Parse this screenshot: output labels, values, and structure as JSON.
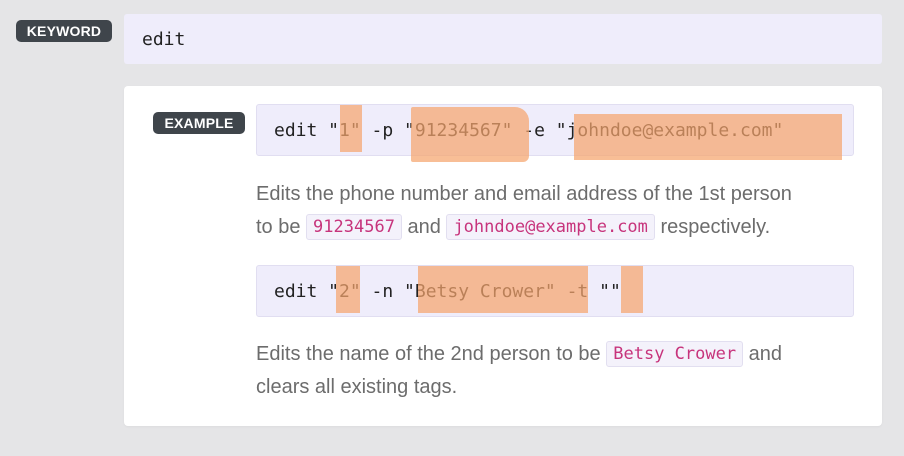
{
  "keyword": {
    "badge": "KEYWORD",
    "value": "edit"
  },
  "example": {
    "badge": "EXAMPLE",
    "code1": "edit \"1\" -p \"91234567\" -e \"johndoe@example.com\"",
    "desc1": {
      "line1": "Edits the phone number and email address of the 1st person",
      "line2_prefix": "to be",
      "code_a": "91234567",
      "mid": "and",
      "code_b": "johndoe@example.com",
      "suffix": "respectively."
    },
    "code2": "edit \"2\" -n \"Betsy Crower\" -t \"\"",
    "desc2": {
      "prefix": "Edits the name of the 2nd person to be",
      "code_a": "Betsy Crower",
      "suffix": "and",
      "line2": "clears all existing tags."
    }
  },
  "colors": {
    "background": "#e5e5e7",
    "badge": "#3f454b",
    "code_bg": "#efedfb",
    "highlight": "#f5a56e",
    "inline_code_text": "#c7347c"
  }
}
